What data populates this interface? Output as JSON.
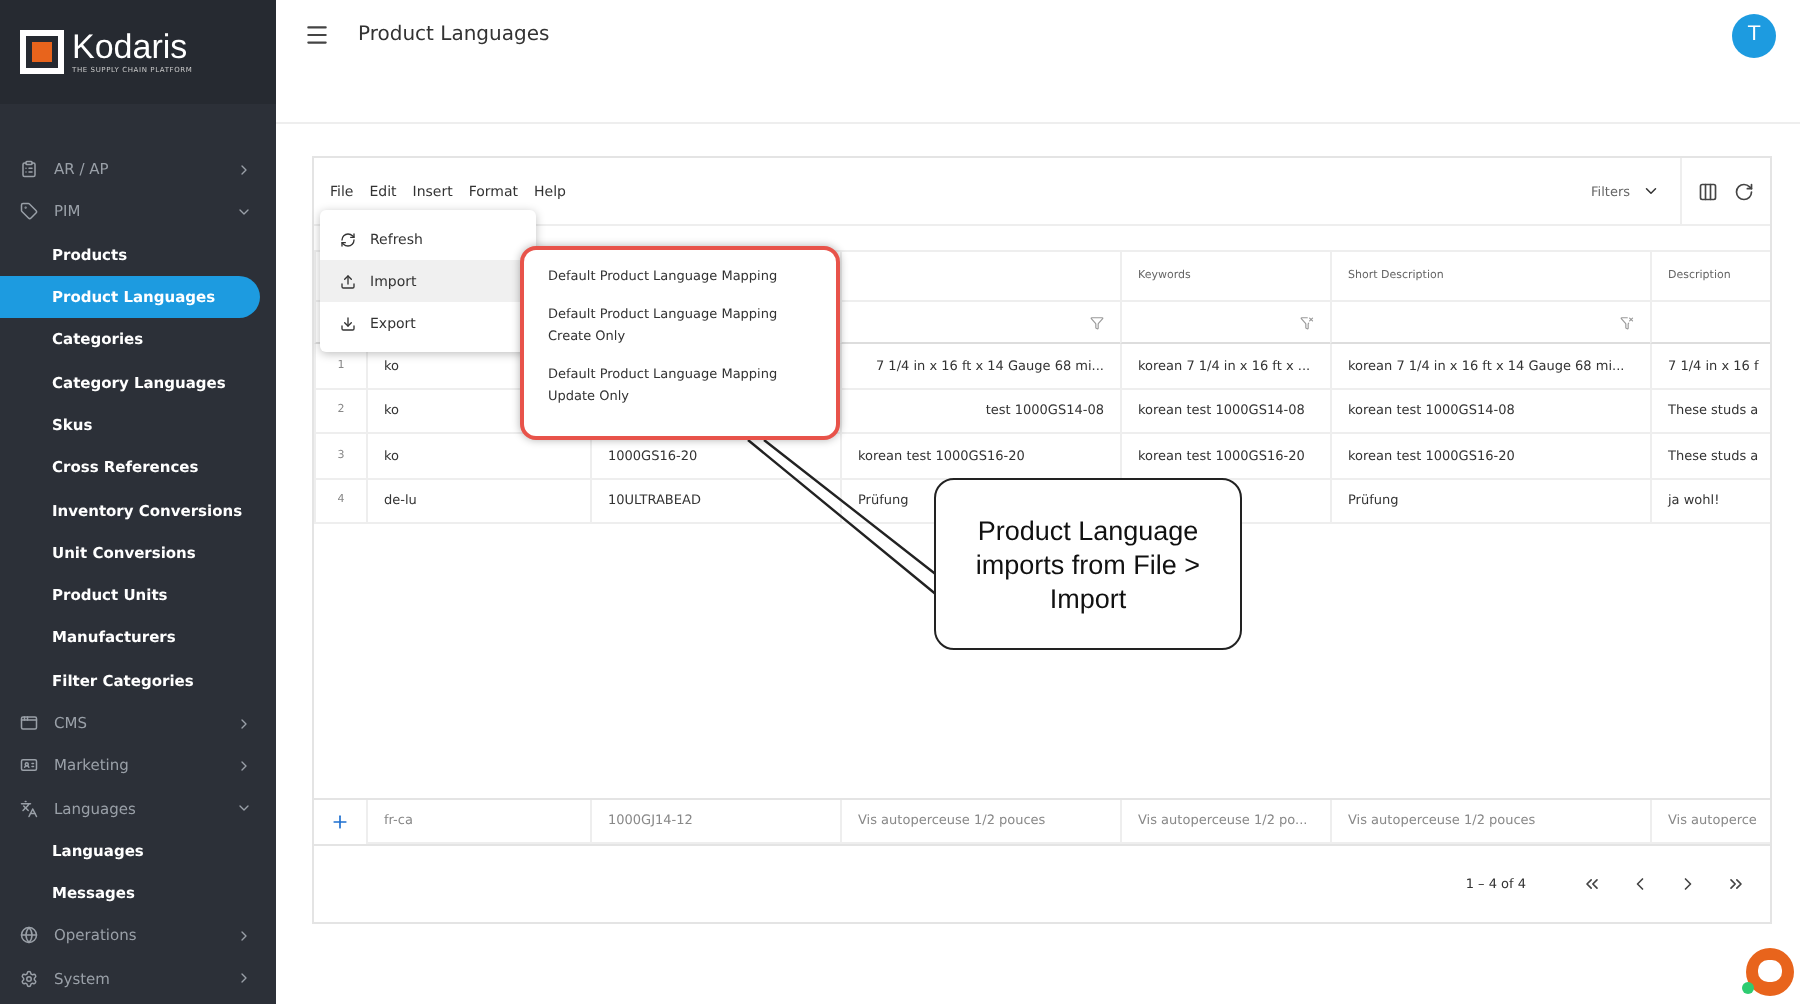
{
  "brand": {
    "name": "Kodaris",
    "tagline": "THE SUPPLY CHAIN PLATFORM"
  },
  "sidebar": {
    "items": [
      {
        "label": "AR / AP",
        "expanded": false,
        "selected": false
      },
      {
        "label": "PIM",
        "expanded": true,
        "selected": false,
        "children": [
          {
            "label": "Products",
            "selected": false
          },
          {
            "label": "Product Languages",
            "selected": true
          },
          {
            "label": "Categories",
            "selected": false
          },
          {
            "label": "Category Languages",
            "selected": false
          },
          {
            "label": "Skus",
            "selected": false
          },
          {
            "label": "Cross References",
            "selected": false
          },
          {
            "label": "Inventory Conversions",
            "selected": false
          },
          {
            "label": "Unit Conversions",
            "selected": false
          },
          {
            "label": "Product Units",
            "selected": false
          },
          {
            "label": "Manufacturers",
            "selected": false
          },
          {
            "label": "Filter Categories",
            "selected": false
          }
        ]
      },
      {
        "label": "CMS",
        "expanded": false,
        "selected": false
      },
      {
        "label": "Marketing",
        "expanded": false,
        "selected": false
      },
      {
        "label": "Languages",
        "expanded": true,
        "selected": false,
        "children": [
          {
            "label": "Languages",
            "selected": false
          },
          {
            "label": "Messages",
            "selected": false
          }
        ]
      },
      {
        "label": "Operations",
        "expanded": false,
        "selected": false
      },
      {
        "label": "System",
        "expanded": false,
        "selected": false
      }
    ]
  },
  "header": {
    "title": "Product Languages",
    "avatar": "T"
  },
  "menubar": [
    "File",
    "Edit",
    "Insert",
    "Format",
    "Help"
  ],
  "filters": "Filters",
  "file_menu": [
    {
      "label": "Refresh",
      "selected": false
    },
    {
      "label": "Import",
      "selected": true
    },
    {
      "label": "Export",
      "selected": false
    }
  ],
  "import_submenu": [
    "Default Product Language Mapping",
    "Default Product Language Mapping Create Only",
    "Default Product Language Mapping Update Only"
  ],
  "table": {
    "columns": [
      "Keywords",
      "Short Description",
      "Description"
    ],
    "rows": [
      {
        "num": "1",
        "lang": "ko",
        "name": "7 1/4 in x 16 ft x 14 Gauge 68 mi...",
        "keywords": "korean 7 1/4 in x 16 ft x ...",
        "short": "korean 7 1/4 in x 16 ft x 14 Gauge 68 mi...",
        "desc": "7 1/4 in x 16 f"
      },
      {
        "num": "2",
        "lang": "ko",
        "name": "test 1000GS14-08",
        "keywords": "korean test 1000GS14-08",
        "short": "korean test 1000GS14-08",
        "desc": "These studs a"
      },
      {
        "num": "3",
        "lang": "ko",
        "code": "1000GS16-20",
        "name": "korean test 1000GS16-20",
        "keywords": "korean test 1000GS16-20",
        "short": "korean test 1000GS16-20",
        "desc": "These studs a"
      },
      {
        "num": "4",
        "lang": "de-lu",
        "code": "10ULTRABEAD",
        "name": "Prüfung",
        "short": "Prüfung",
        "desc": "ja wohl!"
      }
    ],
    "new_row": {
      "lang": "fr-ca",
      "code": "1000GJ14-12",
      "name": "Vis autoperceuse 1/2 pouces",
      "keywords": "Vis autoperceuse 1/2 po...",
      "short": "Vis autoperceuse 1/2 pouces",
      "desc": "Vis autoperce"
    },
    "pagination": "1 – 4 of 4"
  },
  "callout": "Product Language imports from File > Import"
}
